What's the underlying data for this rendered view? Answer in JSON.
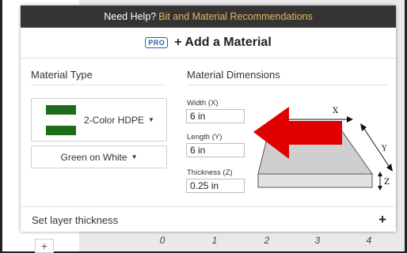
{
  "help_bar": {
    "prefix": "Need Help?",
    "link": "Bit and Material Recommendations"
  },
  "dialog": {
    "pro_badge": "PRO",
    "title": "+ Add a Material"
  },
  "material_type": {
    "heading": "Material Type",
    "material": "2-Color HDPE",
    "swatch_colors": {
      "outer": "#1e6d1a",
      "inner": "#ffffff"
    },
    "color_option": "Green on White"
  },
  "dimensions": {
    "heading": "Material Dimensions",
    "width_label": "Width (X)",
    "width_value": "6 in",
    "length_label": "Length (Y)",
    "length_value": "6 in",
    "thickness_label": "Thickness (Z)",
    "thickness_value": "0.25 in",
    "axis_x": "X",
    "axis_y": "Y",
    "axis_z": "Z",
    "arrow_color": "#e00000"
  },
  "footer": {
    "label": "Set layer thickness",
    "plus": "+"
  },
  "background": {
    "ruler": [
      "0",
      "1",
      "2",
      "3",
      "4"
    ],
    "plus": "+"
  }
}
